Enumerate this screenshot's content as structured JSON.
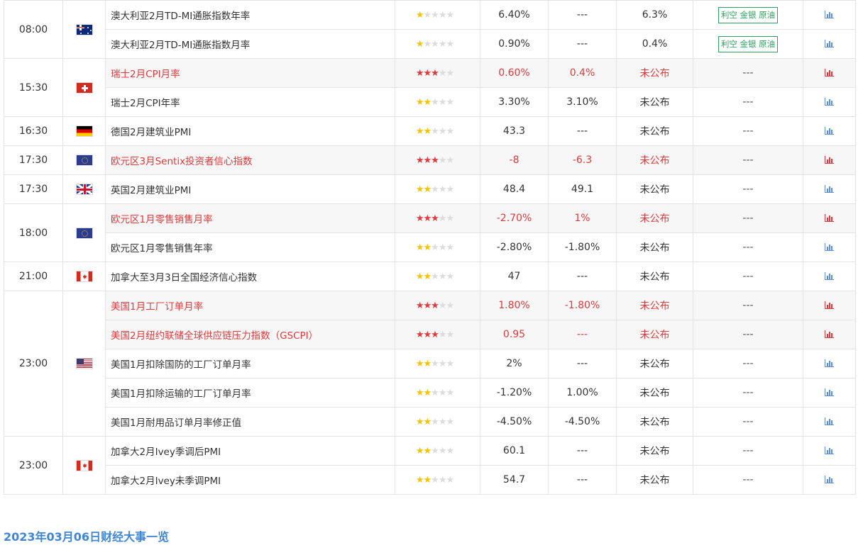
{
  "rows": [
    {
      "time": "08:00",
      "country": "australia-flag",
      "event": "澳大利亚2月TD-MI通胀指数年率",
      "stars": 1,
      "important": false,
      "previous": "6.40%",
      "forecast": "---",
      "actual": "6.3%",
      "impact": "利空 金银 原油"
    },
    {
      "time": "",
      "country": "",
      "event": "澳大利亚2月TD-MI通胀指数月率",
      "stars": 1,
      "important": false,
      "previous": "0.90%",
      "forecast": "---",
      "actual": "0.4%",
      "impact": "利空 金银 原油"
    },
    {
      "time": "15:30",
      "country": "switzerland-flag",
      "event": "瑞士2月CPI月率",
      "stars": 3,
      "important": true,
      "previous": "0.60%",
      "forecast": "0.4%",
      "actual": "未公布",
      "impact": "---"
    },
    {
      "time": "",
      "country": "",
      "event": "瑞士2月CPI年率",
      "stars": 2,
      "important": false,
      "previous": "3.30%",
      "forecast": "3.10%",
      "actual": "未公布",
      "impact": "---"
    },
    {
      "time": "16:30",
      "country": "germany-flag",
      "event": "德国2月建筑业PMI",
      "stars": 2,
      "important": false,
      "previous": "43.3",
      "forecast": "---",
      "actual": "未公布",
      "impact": "---"
    },
    {
      "time": "17:30",
      "country": "eurozone-flag",
      "event": "欧元区3月Sentix投资者信心指数",
      "stars": 3,
      "important": true,
      "previous": "-8",
      "forecast": "-6.3",
      "actual": "未公布",
      "impact": "---"
    },
    {
      "time": "17:30",
      "country": "uk-flag",
      "event": "英国2月建筑业PMI",
      "stars": 2,
      "important": false,
      "previous": "48.4",
      "forecast": "49.1",
      "actual": "未公布",
      "impact": "---"
    },
    {
      "time": "18:00",
      "country": "eurozone-flag",
      "event": "欧元区1月零售销售月率",
      "stars": 3,
      "important": true,
      "previous": "-2.70%",
      "forecast": "1%",
      "actual": "未公布",
      "impact": "---"
    },
    {
      "time": "",
      "country": "",
      "event": "欧元区1月零售销售年率",
      "stars": 2,
      "important": false,
      "previous": "-2.80%",
      "forecast": "-1.80%",
      "actual": "未公布",
      "impact": "---"
    },
    {
      "time": "21:00",
      "country": "canada-flag",
      "event": "加拿大至3月3日全国经济信心指数",
      "stars": 2,
      "important": false,
      "previous": "47",
      "forecast": "---",
      "actual": "未公布",
      "impact": "---"
    },
    {
      "time": "23:00",
      "country": "usa-flag",
      "event": "美国1月工厂订单月率",
      "stars": 3,
      "important": true,
      "previous": "1.80%",
      "forecast": "-1.80%",
      "actual": "未公布",
      "impact": "---"
    },
    {
      "time": "",
      "country": "",
      "event": "美国2月纽约联储全球供应链压力指数（GSCPI）",
      "stars": 3,
      "important": true,
      "previous": "0.95",
      "forecast": "---",
      "actual": "未公布",
      "impact": "---"
    },
    {
      "time": "",
      "country": "",
      "event": "美国1月扣除国防的工厂订单月率",
      "stars": 2,
      "important": false,
      "previous": "2%",
      "forecast": "---",
      "actual": "未公布",
      "impact": "---"
    },
    {
      "time": "",
      "country": "",
      "event": "美国1月扣除运输的工厂订单月率",
      "stars": 2,
      "important": false,
      "previous": "-1.20%",
      "forecast": "1.00%",
      "actual": "未公布",
      "impact": "---"
    },
    {
      "time": "",
      "country": "",
      "event": "美国1月耐用品订单月率修正值",
      "stars": 2,
      "important": false,
      "previous": "-4.50%",
      "forecast": "-4.50%",
      "actual": "未公布",
      "impact": "---"
    },
    {
      "time": "23:00",
      "country": "canada-flag",
      "event": "加拿大2月Ivey季调后PMI",
      "stars": 2,
      "important": false,
      "previous": "60.1",
      "forecast": "---",
      "actual": "未公布",
      "impact": "---"
    },
    {
      "time": "",
      "country": "",
      "event": "加拿大2月Ivey未季调PMI",
      "stars": 2,
      "important": false,
      "previous": "54.7",
      "forecast": "---",
      "actual": "未公布",
      "impact": "---"
    }
  ],
  "groups": [
    {
      "start": 0,
      "span": 2,
      "time": "08:00",
      "flag": "au"
    },
    {
      "start": 2,
      "span": 2,
      "time": "15:30",
      "flag": "ch"
    },
    {
      "start": 4,
      "span": 1,
      "time": "16:30",
      "flag": "de"
    },
    {
      "start": 5,
      "span": 1,
      "time": "17:30",
      "flag": "eu"
    },
    {
      "start": 6,
      "span": 1,
      "time": "17:30",
      "flag": "gb"
    },
    {
      "start": 7,
      "span": 2,
      "time": "18:00",
      "flag": "eu"
    },
    {
      "start": 9,
      "span": 1,
      "time": "21:00",
      "flag": "ca"
    },
    {
      "start": 10,
      "span": 5,
      "time": "23:00",
      "flag": "us"
    },
    {
      "start": 15,
      "span": 2,
      "time": "23:00",
      "flag": "ca"
    }
  ],
  "colors": {
    "important": "#e4393c",
    "star_normal": "#f5c400",
    "impact_tag": "#2aa35f",
    "link_title": "#3f86d6"
  },
  "footer": {
    "title": "2023年03月06日财经大事一览"
  }
}
